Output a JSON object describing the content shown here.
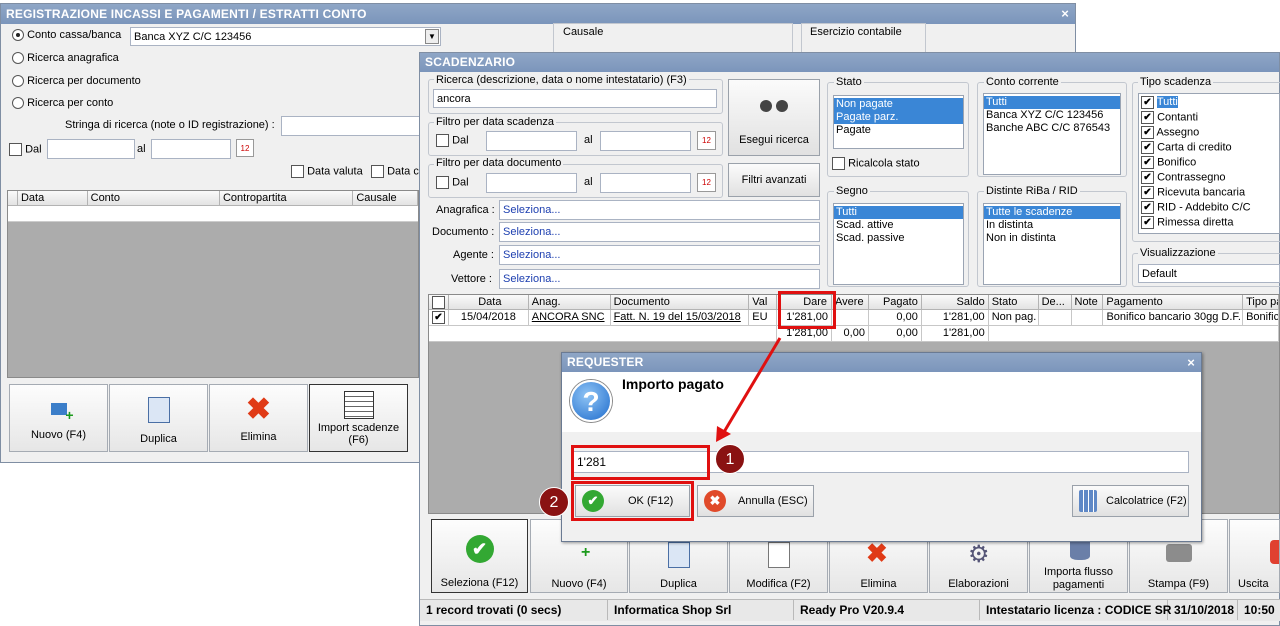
{
  "back": {
    "title": "REGISTRAZIONE INCASSI E PAGAMENTI / ESTRATTI CONTO",
    "close": "×",
    "radios": [
      "Conto cassa/banca",
      "Ricerca anagrafica",
      "Ricerca per documento",
      "Ricerca per conto"
    ],
    "conto_value": "Banca XYZ C/C 123456",
    "causale_label": "Causale",
    "esercizio_label": "Esercizio contabile",
    "stringa_label": "Stringa di ricerca (note o ID registrazione) :",
    "dal": "Dal",
    "al": "al",
    "data_valuta": "Data valuta",
    "data_c": "Data c",
    "cols": [
      "Data",
      "Conto",
      "Contropartita",
      "Causale"
    ],
    "buttons": [
      "Nuovo (F4)",
      "Duplica",
      "Elimina",
      "Import scadenze (F6)"
    ]
  },
  "scad": {
    "title": "SCADENZARIO",
    "ricerca_label": "Ricerca (descrizione, data o nome intestatario) (F3)",
    "ricerca_value": "ancora",
    "filtro_scad": "Filtro per data scadenza",
    "filtro_doc": "Filtro per data documento",
    "dal": "Dal",
    "al": "al",
    "esegui": "Esegui ricerca",
    "filtri_avanzati": "Filtri avanzati",
    "fields": [
      {
        "label": "Anagrafica :",
        "value": "Seleziona..."
      },
      {
        "label": "Documento :",
        "value": "Seleziona..."
      },
      {
        "label": "Agente :",
        "value": "Seleziona..."
      },
      {
        "label": "Vettore :",
        "value": "Seleziona..."
      }
    ],
    "stato_label": "Stato",
    "stato_items": [
      "Non pagate",
      "Pagate parz.",
      "Pagate"
    ],
    "ricalcola": "Ricalcola stato",
    "segno_label": "Segno",
    "segno_items": [
      "Tutti",
      "Scad. attive",
      "Scad. passive"
    ],
    "conto_label": "Conto corrente",
    "conto_items": [
      "Tutti",
      "Banca XYZ C/C 123456",
      "Banche ABC C/C 876543"
    ],
    "distinte_label": "Distinte RiBa / RID",
    "distinte_items": [
      "Tutte le scadenze",
      "In distinta",
      "Non in distinta"
    ],
    "tipo_label": "Tipo scadenza",
    "tipo_items": [
      "Tutti",
      "Contanti",
      "Assegno",
      "Carta di credito",
      "Bonifico",
      "Contrassegno",
      "Ricevuta bancaria",
      "RID - Addebito C/C",
      "Rimessa diretta"
    ],
    "vis_label": "Visualizzazione",
    "vis_value": "Default",
    "cols": [
      "Data",
      "Anag.",
      "Documento",
      "Val",
      "Dare",
      "Avere",
      "Pagato",
      "Saldo",
      "Stato",
      "De...",
      "Note",
      "Pagamento",
      "Tipo pa"
    ],
    "row1": [
      "15/04/2018",
      "ANCORA SNC",
      "Fatt. N. 19 del 15/03/2018",
      "EU",
      "1'281,00",
      "",
      "0,00",
      "1'281,00",
      "Non pag.",
      "",
      "",
      "Bonifico bancario 30gg D.F.",
      "Bonific"
    ],
    "totals": [
      "1'281,00",
      "0,00",
      "0,00",
      "1'281,00"
    ],
    "buttons": [
      "Seleziona (F12)",
      "Nuovo (F4)",
      "Duplica",
      "Modifica (F2)",
      "Elimina",
      "Elaborazioni",
      "Importa flusso pagamenti",
      "Stampa (F9)",
      "Uscita"
    ],
    "status": [
      "1 record trovati (0 secs)",
      "Informatica Shop Srl",
      "Ready Pro V20.9.4",
      "Intestatario licenza : CODICE SR",
      "31/10/2018",
      "10:50"
    ]
  },
  "req": {
    "title": "REQUESTER",
    "close": "×",
    "heading": "Importo pagato",
    "value": "1'281",
    "ok": "OK (F12)",
    "annulla": "Annulla (ESC)",
    "calc": "Calcolatrice (F2)",
    "badge1": "1",
    "badge2": "2"
  },
  "colors": {
    "title": "#7b95bb",
    "highlight": "#e01010",
    "selection": "#3a86d6",
    "badge": "#8a1212"
  }
}
